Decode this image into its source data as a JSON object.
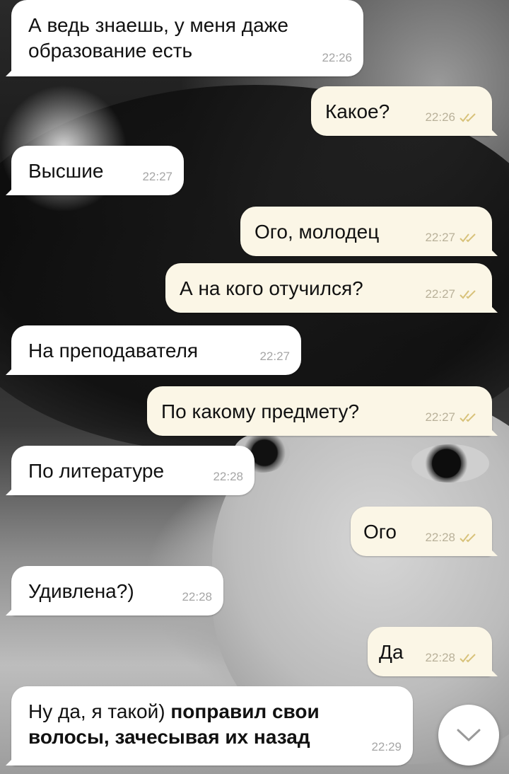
{
  "messages": [
    {
      "dir": "in",
      "text": "А ведь знаешь, у меня даже",
      "text2": "образование есть",
      "time": "22:26"
    },
    {
      "dir": "out",
      "text": "Какое?",
      "time": "22:26"
    },
    {
      "dir": "in",
      "text": "Высшие",
      "time": "22:27"
    },
    {
      "dir": "out",
      "text": "Ого, молодец",
      "time": "22:27"
    },
    {
      "dir": "out",
      "text": "А на кого отучился?",
      "time": "22:27"
    },
    {
      "dir": "in",
      "text": "На преподавателя",
      "time": "22:27"
    },
    {
      "dir": "out",
      "text": "По какому предмету?",
      "time": "22:27"
    },
    {
      "dir": "in",
      "text": "По литературе",
      "time": "22:28"
    },
    {
      "dir": "out",
      "text": "Ого",
      "time": "22:28"
    },
    {
      "dir": "in",
      "text": "Удивлена?)",
      "time": "22:28"
    },
    {
      "dir": "out",
      "text": "Да",
      "time": "22:28"
    },
    {
      "dir": "in",
      "text_plain": "Ну да, я такой) ",
      "text_bold": "поправил свои",
      "text2_bold": "волосы, зачесывая их назад",
      "time": "22:29"
    }
  ],
  "colors": {
    "incoming_bubble": "#ffffff",
    "outgoing_bubble": "#fbf6e6",
    "read_check": "#d8c27a"
  },
  "icons": {
    "read_status": "double-check-icon",
    "scroll_down": "chevron-down-icon"
  }
}
